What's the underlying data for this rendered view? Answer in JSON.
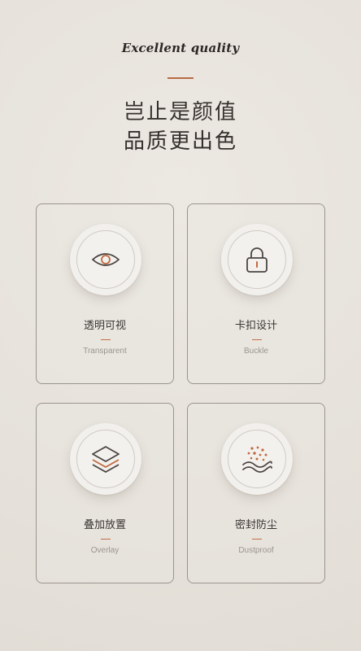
{
  "header": {
    "english_title": "Excellent quality",
    "chinese_title_line1": "岂止是颜值",
    "chinese_title_line2": "品质更出色"
  },
  "colors": {
    "accent": "#b86a45",
    "background": "#e8e4de",
    "text": "#3a3532"
  },
  "features": [
    {
      "icon": "eye-icon",
      "title": "透明可视",
      "subtitle": "Transparent"
    },
    {
      "icon": "lock-icon",
      "title": "卡扣设计",
      "subtitle": "Buckle"
    },
    {
      "icon": "layers-icon",
      "title": "叠加放置",
      "subtitle": "Overlay"
    },
    {
      "icon": "dust-icon",
      "title": "密封防尘",
      "subtitle": "Dustproof"
    }
  ]
}
